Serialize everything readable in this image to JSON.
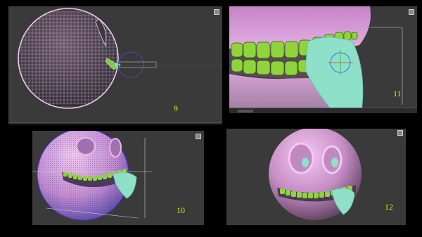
{
  "panels": [
    {
      "id": "panel-9",
      "step": "9"
    },
    {
      "id": "panel-11",
      "step": "11"
    },
    {
      "id": "panel-10",
      "step": "10"
    },
    {
      "id": "panel-12",
      "step": "12"
    }
  ],
  "colors": {
    "background": "#000000",
    "viewport": "#3a3a3a",
    "skin": "#d9a4d6",
    "teeth": "#8fd43c",
    "tongue": "#8fe0c8",
    "wireframe": "#e7b7e4",
    "step_number": "#e6e600"
  }
}
